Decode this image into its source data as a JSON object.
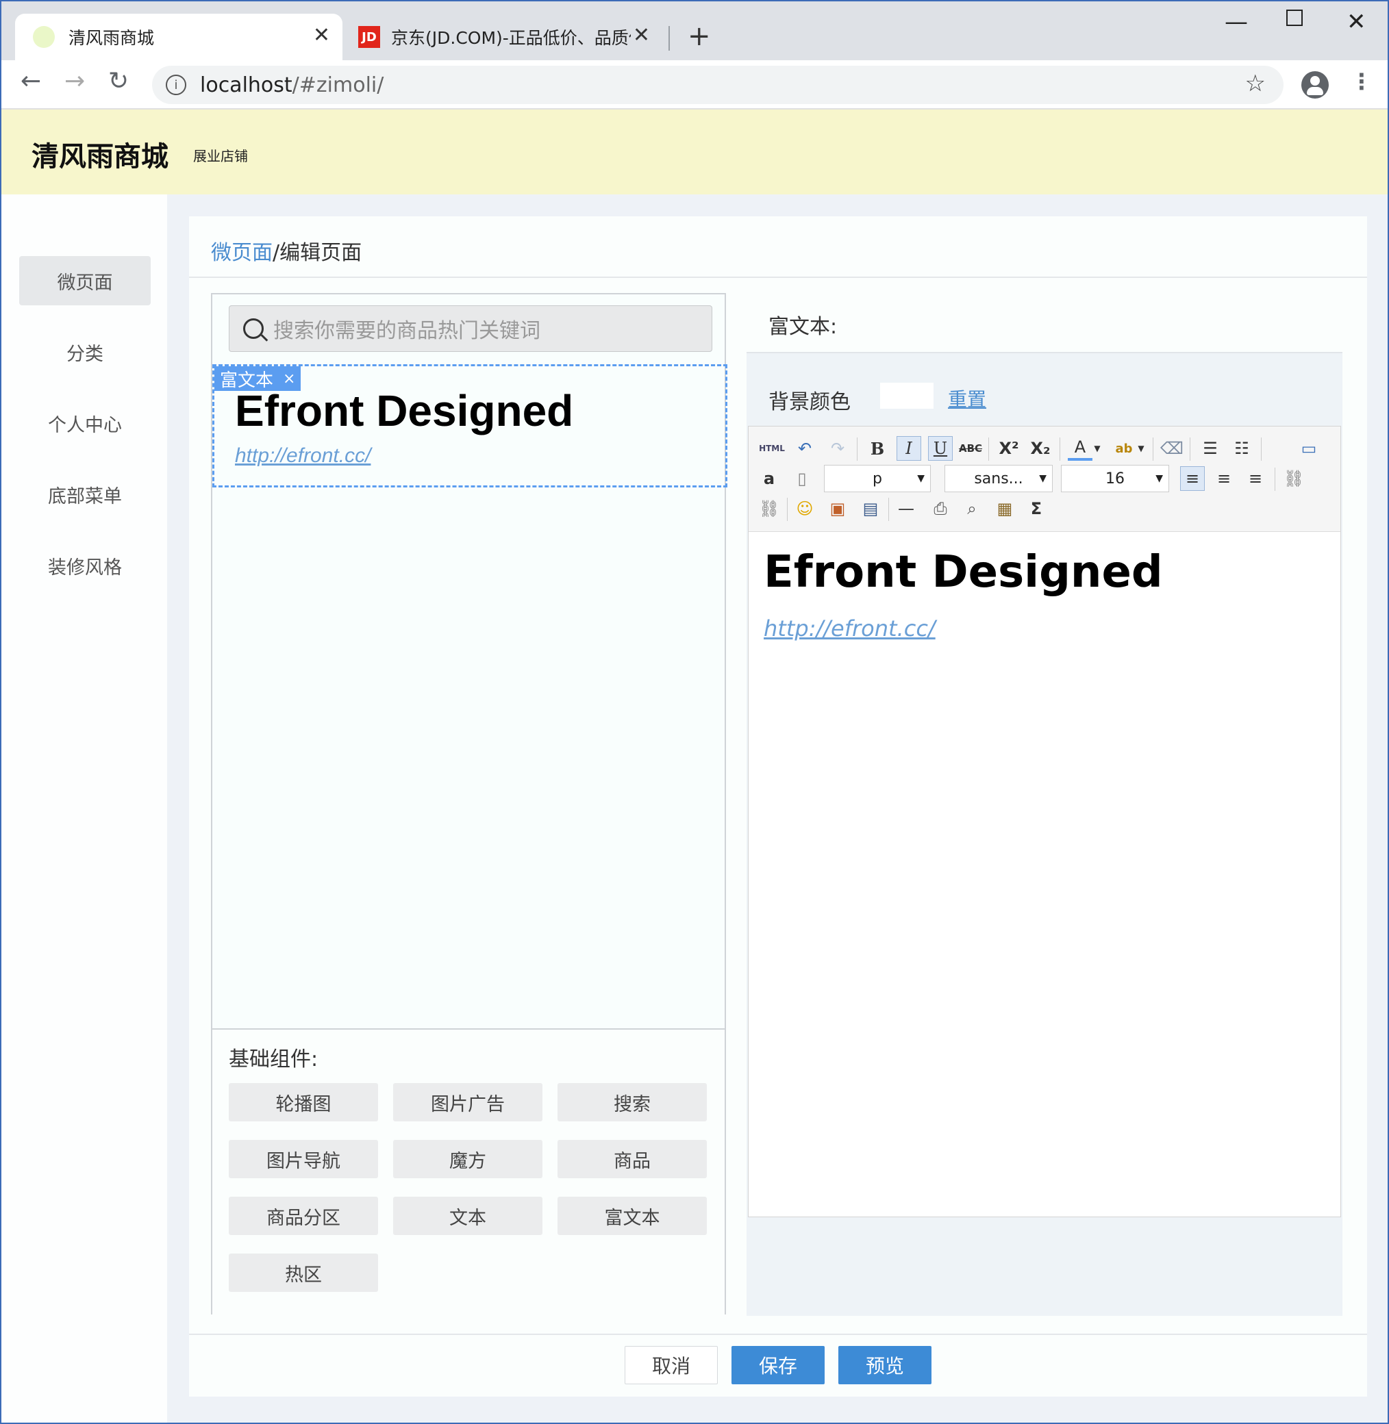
{
  "browser": {
    "tabs": [
      {
        "title": "清风雨商城"
      },
      {
        "title": "京东(JD.COM)-正品低价、品质保",
        "icon_text": "JD"
      }
    ],
    "url": {
      "host": "localhost",
      "path": "/#zimoli/"
    },
    "new_tab": "+"
  },
  "app": {
    "title": "清风雨商城",
    "subtitle": "展业店铺"
  },
  "sidebar": {
    "items": [
      {
        "label": "微页面",
        "active": true
      },
      {
        "label": "分类"
      },
      {
        "label": "个人中心"
      },
      {
        "label": "底部菜单"
      },
      {
        "label": "装修风格"
      }
    ]
  },
  "breadcrumb": {
    "link": "微页面",
    "separator": "/",
    "current": "编辑页面"
  },
  "preview": {
    "search_placeholder": "搜索你需要的商品热门关键词",
    "block_tag": "富文本",
    "block_close": "×",
    "heading": "Efront Designed",
    "link": "http://efront.cc/"
  },
  "palette": {
    "title": "基础组件:",
    "components": [
      "轮播图",
      "图片广告",
      "搜索",
      "图片导航",
      "魔方",
      "商品",
      "商品分区",
      "文本",
      "富文本",
      "热区"
    ]
  },
  "editor": {
    "title": "富文本:",
    "bg_label": "背景颜色",
    "bg_reset": "重置",
    "toolbar": {
      "html_label": "HTML",
      "paragraph": "p",
      "font_family": "sans...",
      "font_size": "16"
    },
    "content_heading": "Efront Designed",
    "content_link": "http://efront.cc/"
  },
  "footer": {
    "cancel": "取消",
    "save": "保存",
    "preview": "预览"
  },
  "colors": {
    "accent": "#3d8bd6",
    "link": "#4a8ccf",
    "header_bg": "#f7f6cc",
    "selection_border": "#5b9df0"
  }
}
